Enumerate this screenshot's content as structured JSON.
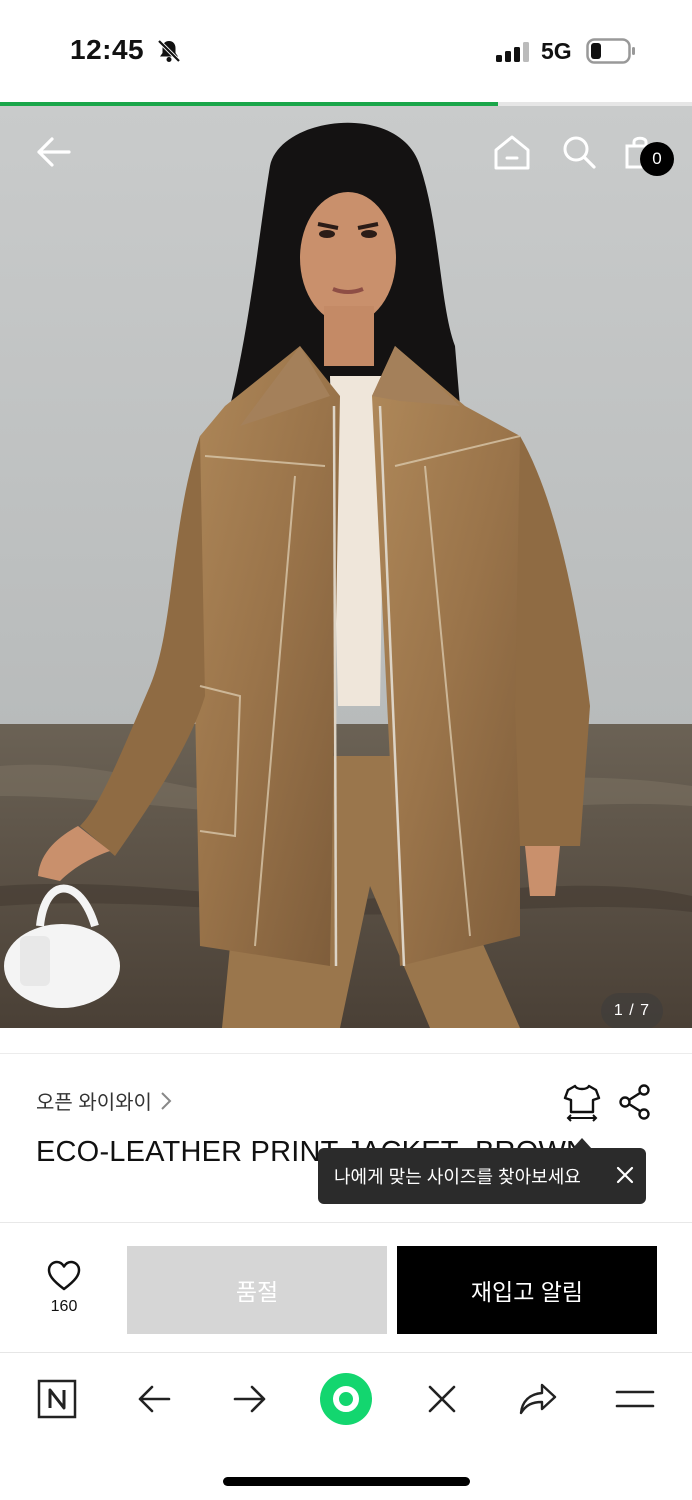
{
  "status_bar": {
    "time": "12:45",
    "network": "5G",
    "icons": [
      "bell-slash-icon",
      "signal-icon",
      "battery-icon"
    ]
  },
  "page_load_progress": 0.72,
  "header": {
    "back_icon": "arrow-left-icon",
    "home_icon": "home-icon",
    "search_icon": "search-icon",
    "cart_icon": "shopping-bag-icon",
    "cart_count": "0"
  },
  "gallery": {
    "indicator": "1 / 7",
    "current": 1,
    "total": 7
  },
  "product": {
    "brand": "오픈 와이와이",
    "title": "ECO-LEATHER PRINT JACKET_BROWN"
  },
  "tooltip": {
    "text": "나에게 맞는 사이즈를 찾아보세요"
  },
  "actions": {
    "like_count": "160",
    "soldout_label": "품절",
    "restock_label": "재입고 알림"
  },
  "browser_bar": {
    "items": [
      "naver-icon",
      "back-icon",
      "forward-icon",
      "green-dot-icon",
      "close-icon",
      "share-icon",
      "menu-icon"
    ]
  },
  "colors": {
    "accent_green": "#1aa64a",
    "soldout_gray": "#d6d6d6",
    "primary_black": "#000000",
    "tooltip_bg": "#2b2b2b"
  }
}
